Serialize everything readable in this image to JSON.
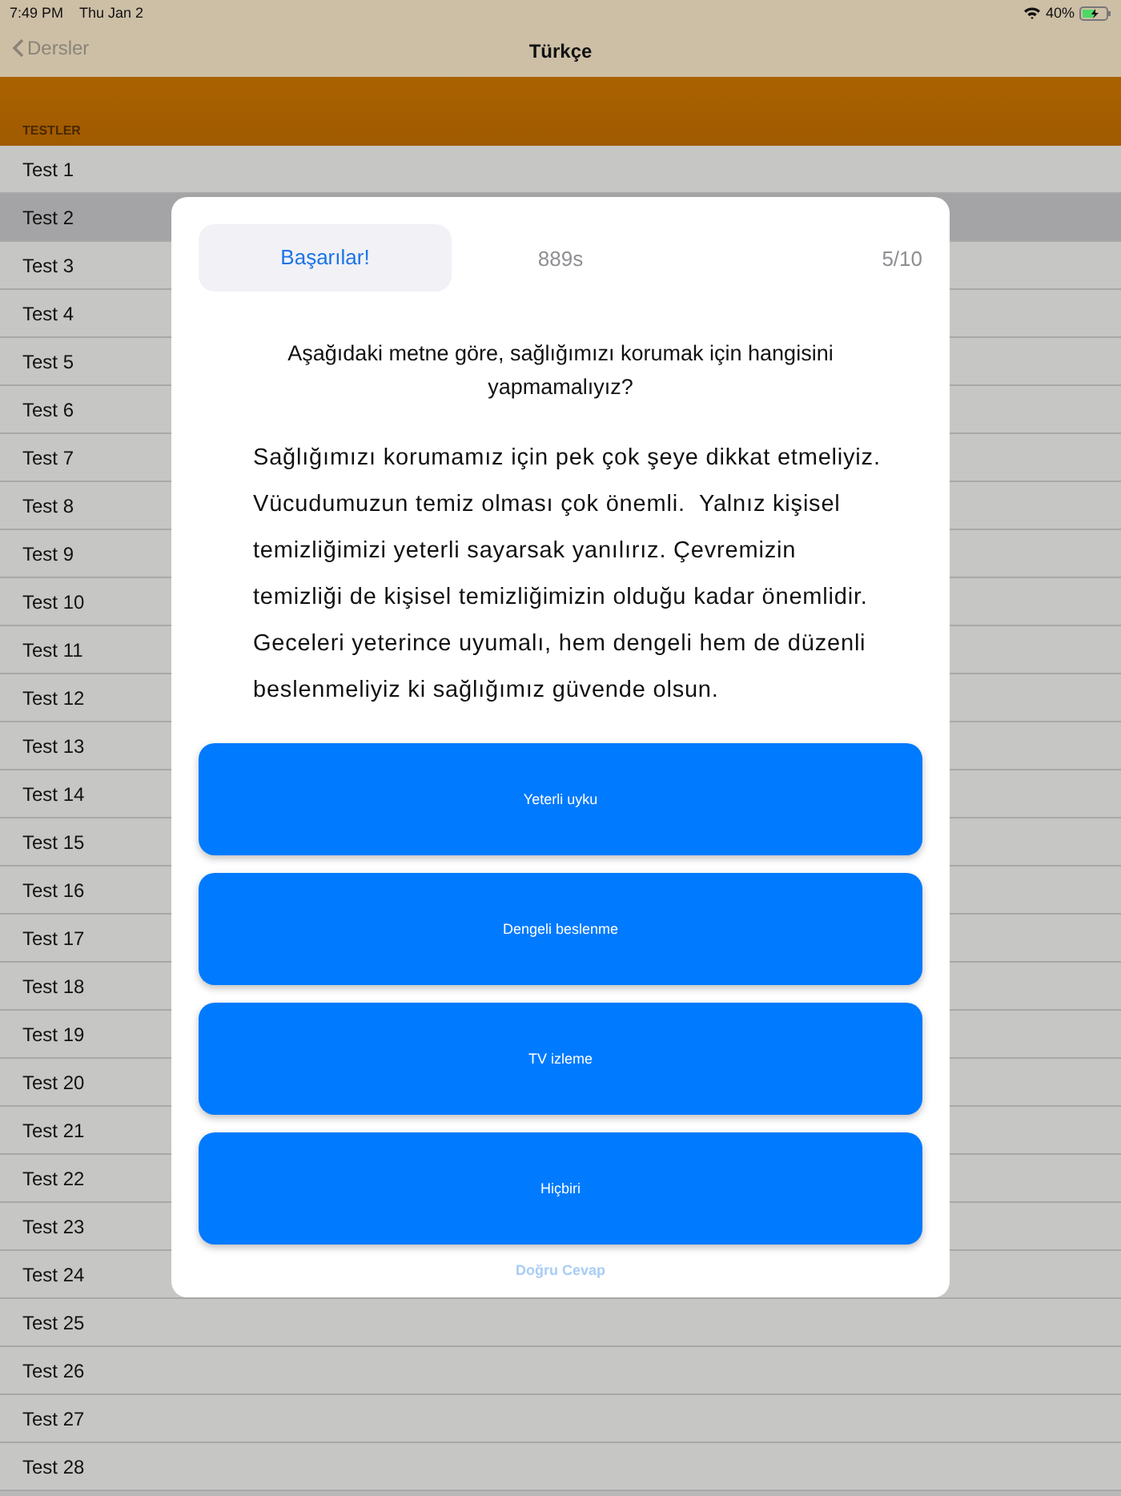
{
  "status_bar": {
    "time": "7:49 PM",
    "date": "Thu Jan 2",
    "battery": "40%"
  },
  "nav": {
    "back": "Dersler",
    "title": "Türkçe"
  },
  "section_header": "TESTLER",
  "tests": [
    {
      "label": "Test 1",
      "selected": false
    },
    {
      "label": "Test 2",
      "selected": true
    },
    {
      "label": "Test 3",
      "selected": false
    },
    {
      "label": "Test 4",
      "selected": false
    },
    {
      "label": "Test 5",
      "selected": false
    },
    {
      "label": "Test 6",
      "selected": false
    },
    {
      "label": "Test 7",
      "selected": false
    },
    {
      "label": "Test 8",
      "selected": false
    },
    {
      "label": "Test 9",
      "selected": false
    },
    {
      "label": "Test 10",
      "selected": false
    },
    {
      "label": "Test 11",
      "selected": false
    },
    {
      "label": "Test 12",
      "selected": false
    },
    {
      "label": "Test 13",
      "selected": false
    },
    {
      "label": "Test 14",
      "selected": false
    },
    {
      "label": "Test 15",
      "selected": false
    },
    {
      "label": "Test 16",
      "selected": false
    },
    {
      "label": "Test 17",
      "selected": false
    },
    {
      "label": "Test 18",
      "selected": false
    },
    {
      "label": "Test 19",
      "selected": false
    },
    {
      "label": "Test 20",
      "selected": false
    },
    {
      "label": "Test 21",
      "selected": false
    },
    {
      "label": "Test 22",
      "selected": false
    },
    {
      "label": "Test 23",
      "selected": false
    },
    {
      "label": "Test 24",
      "selected": false
    },
    {
      "label": "Test 25",
      "selected": false
    },
    {
      "label": "Test 26",
      "selected": false
    },
    {
      "label": "Test 27",
      "selected": false
    },
    {
      "label": "Test 28",
      "selected": false
    }
  ],
  "quiz": {
    "header": [
      {
        "label": "Başarılar!",
        "selected": true
      },
      {
        "label": "889s",
        "selected": false
      },
      {
        "label": "5/10",
        "selected": false
      }
    ],
    "question": "Aşağıdaki metne göre, sağlığımızı korumak için hangisini yapmamalıyız?",
    "passage": [
      "Sağlığımızı korumamız için pek çok şeye dikkat etmeliyiz.",
      "Vücudumuzun temiz olması çok önemli.  Yalnız kişisel",
      "temizliğimizi yeterli sayarsak yanılırız. Çevremizin",
      "temizliği de kişisel temizliğimizin olduğu kadar önemlidir.",
      "Geceleri yeterince uyumalı, hem dengeli hem de düzenli",
      "beslenmeliyiz ki sağlığımız güvende olsun."
    ],
    "options": [
      {
        "label": "Yeterli uyku"
      },
      {
        "label": "Dengeli beslenme"
      },
      {
        "label": "TV izleme"
      },
      {
        "label": "Hiçbiri"
      }
    ],
    "answer_button": {
      "label": "Doğru Cevap",
      "disabled": true
    }
  }
}
